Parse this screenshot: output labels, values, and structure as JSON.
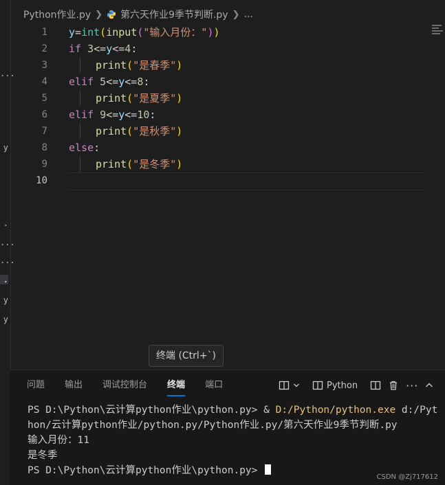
{
  "breadcrumb": {
    "folder": "Python作业.py",
    "file": "第六天作业9季节判断.py",
    "more": "..."
  },
  "editor": {
    "lines": [
      {
        "num": "1"
      },
      {
        "num": "2"
      },
      {
        "num": "3"
      },
      {
        "num": "4"
      },
      {
        "num": "5"
      },
      {
        "num": "6"
      },
      {
        "num": "7"
      },
      {
        "num": "8"
      },
      {
        "num": "9"
      },
      {
        "num": "10"
      }
    ],
    "tokens": {
      "l1": [
        "y",
        "=",
        "int",
        "(",
        "input",
        "(",
        "\"输入月份：\"",
        ")",
        ")"
      ],
      "l2": [
        "if",
        " ",
        "3",
        "<=",
        "y",
        "<=",
        "4",
        ":"
      ],
      "l3": [
        "print",
        "(",
        "\"是春季\"",
        ")"
      ],
      "l4": [
        "elif",
        " ",
        "5",
        "<=",
        "y",
        "<=",
        "8",
        ":"
      ],
      "l5": [
        "print",
        "(",
        "\"是夏季\"",
        ")"
      ],
      "l6": [
        "elif",
        " ",
        "9",
        "<=",
        "y",
        "<=",
        "10",
        ":"
      ],
      "l7": [
        "print",
        "(",
        "\"是秋季\"",
        ")"
      ],
      "l8": [
        "else",
        ":"
      ],
      "l9": [
        "print",
        "(",
        "\"是冬季\"",
        ")"
      ]
    }
  },
  "tooltip": "终端 (Ctrl+`)",
  "panel": {
    "tabs": [
      "问题",
      "输出",
      "调试控制台",
      "终端",
      "端口"
    ],
    "active_tab": "终端",
    "terminal_profile": "Python",
    "terminal_lines": {
      "prompt1": "PS D:\\Python\\云计算python作业\\python.py> & ",
      "exe": "D:/Python/python.exe",
      "args": " d:/Python/云计算python作业/python.py/Python作业.py/第六天作业9季节判断.py",
      "out1": "输入月份：11",
      "out2": "是冬季",
      "prompt2": "PS D:\\Python\\云计算python作业\\python.py> "
    }
  },
  "left_strip": [
    "...",
    "y",
    ".",
    "...",
    "...",
    ".",
    "y",
    "y"
  ],
  "watermark": "CSDN @Zj717612",
  "colors": {
    "accent": "#0078d4",
    "keyword": "#c586c0",
    "string": "#ce9178",
    "number": "#b5cea8",
    "function": "#dcdcaa",
    "builtin": "#4ec9b0"
  }
}
